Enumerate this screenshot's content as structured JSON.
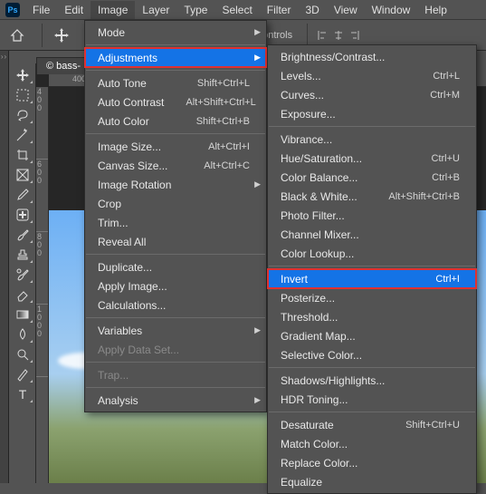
{
  "menubar": {
    "items": [
      "File",
      "Edit",
      "Image",
      "Layer",
      "Type",
      "Select",
      "Filter",
      "3D",
      "View",
      "Window",
      "Help"
    ],
    "open_index": 2
  },
  "optionsbar": {
    "label": "Show Transform Controls"
  },
  "doc_tab": "© bass-",
  "ruler_h": [
    "400"
  ],
  "ruler_v": [
    "4\n0\n0",
    "6\n0\n0",
    "8\n0\n0",
    "1\n0\n0\n0"
  ],
  "image_menu": [
    {
      "label": "Mode",
      "arrow": true
    },
    {
      "divider": true
    },
    {
      "label": "Adjustments",
      "arrow": true,
      "selected": true,
      "red": true
    },
    {
      "divider": true
    },
    {
      "label": "Auto Tone",
      "shortcut": "Shift+Ctrl+L"
    },
    {
      "label": "Auto Contrast",
      "shortcut": "Alt+Shift+Ctrl+L"
    },
    {
      "label": "Auto Color",
      "shortcut": "Shift+Ctrl+B"
    },
    {
      "divider": true
    },
    {
      "label": "Image Size...",
      "shortcut": "Alt+Ctrl+I"
    },
    {
      "label": "Canvas Size...",
      "shortcut": "Alt+Ctrl+C"
    },
    {
      "label": "Image Rotation",
      "arrow": true
    },
    {
      "label": "Crop"
    },
    {
      "label": "Trim..."
    },
    {
      "label": "Reveal All"
    },
    {
      "divider": true
    },
    {
      "label": "Duplicate..."
    },
    {
      "label": "Apply Image..."
    },
    {
      "label": "Calculations..."
    },
    {
      "divider": true
    },
    {
      "label": "Variables",
      "arrow": true
    },
    {
      "label": "Apply Data Set...",
      "disabled": true
    },
    {
      "divider": true
    },
    {
      "label": "Trap...",
      "disabled": true
    },
    {
      "divider": true
    },
    {
      "label": "Analysis",
      "arrow": true
    }
  ],
  "adjust_menu": [
    {
      "label": "Brightness/Contrast..."
    },
    {
      "label": "Levels...",
      "shortcut": "Ctrl+L"
    },
    {
      "label": "Curves...",
      "shortcut": "Ctrl+M"
    },
    {
      "label": "Exposure..."
    },
    {
      "divider": true
    },
    {
      "label": "Vibrance..."
    },
    {
      "label": "Hue/Saturation...",
      "shortcut": "Ctrl+U"
    },
    {
      "label": "Color Balance...",
      "shortcut": "Ctrl+B"
    },
    {
      "label": "Black & White...",
      "shortcut": "Alt+Shift+Ctrl+B"
    },
    {
      "label": "Photo Filter..."
    },
    {
      "label": "Channel Mixer..."
    },
    {
      "label": "Color Lookup..."
    },
    {
      "divider": true
    },
    {
      "label": "Invert",
      "shortcut": "Ctrl+I",
      "selected": true,
      "red": true
    },
    {
      "label": "Posterize..."
    },
    {
      "label": "Threshold..."
    },
    {
      "label": "Gradient Map..."
    },
    {
      "label": "Selective Color..."
    },
    {
      "divider": true
    },
    {
      "label": "Shadows/Highlights..."
    },
    {
      "label": "HDR Toning..."
    },
    {
      "divider": true
    },
    {
      "label": "Desaturate",
      "shortcut": "Shift+Ctrl+U"
    },
    {
      "label": "Match Color..."
    },
    {
      "label": "Replace Color..."
    },
    {
      "label": "Equalize"
    }
  ],
  "tools": [
    "move",
    "marquee",
    "lasso",
    "wand",
    "crop",
    "frame",
    "eyedropper",
    "healing",
    "brush",
    "stamp",
    "history-brush",
    "eraser",
    "gradient",
    "blur",
    "dodge",
    "pen",
    "type"
  ]
}
